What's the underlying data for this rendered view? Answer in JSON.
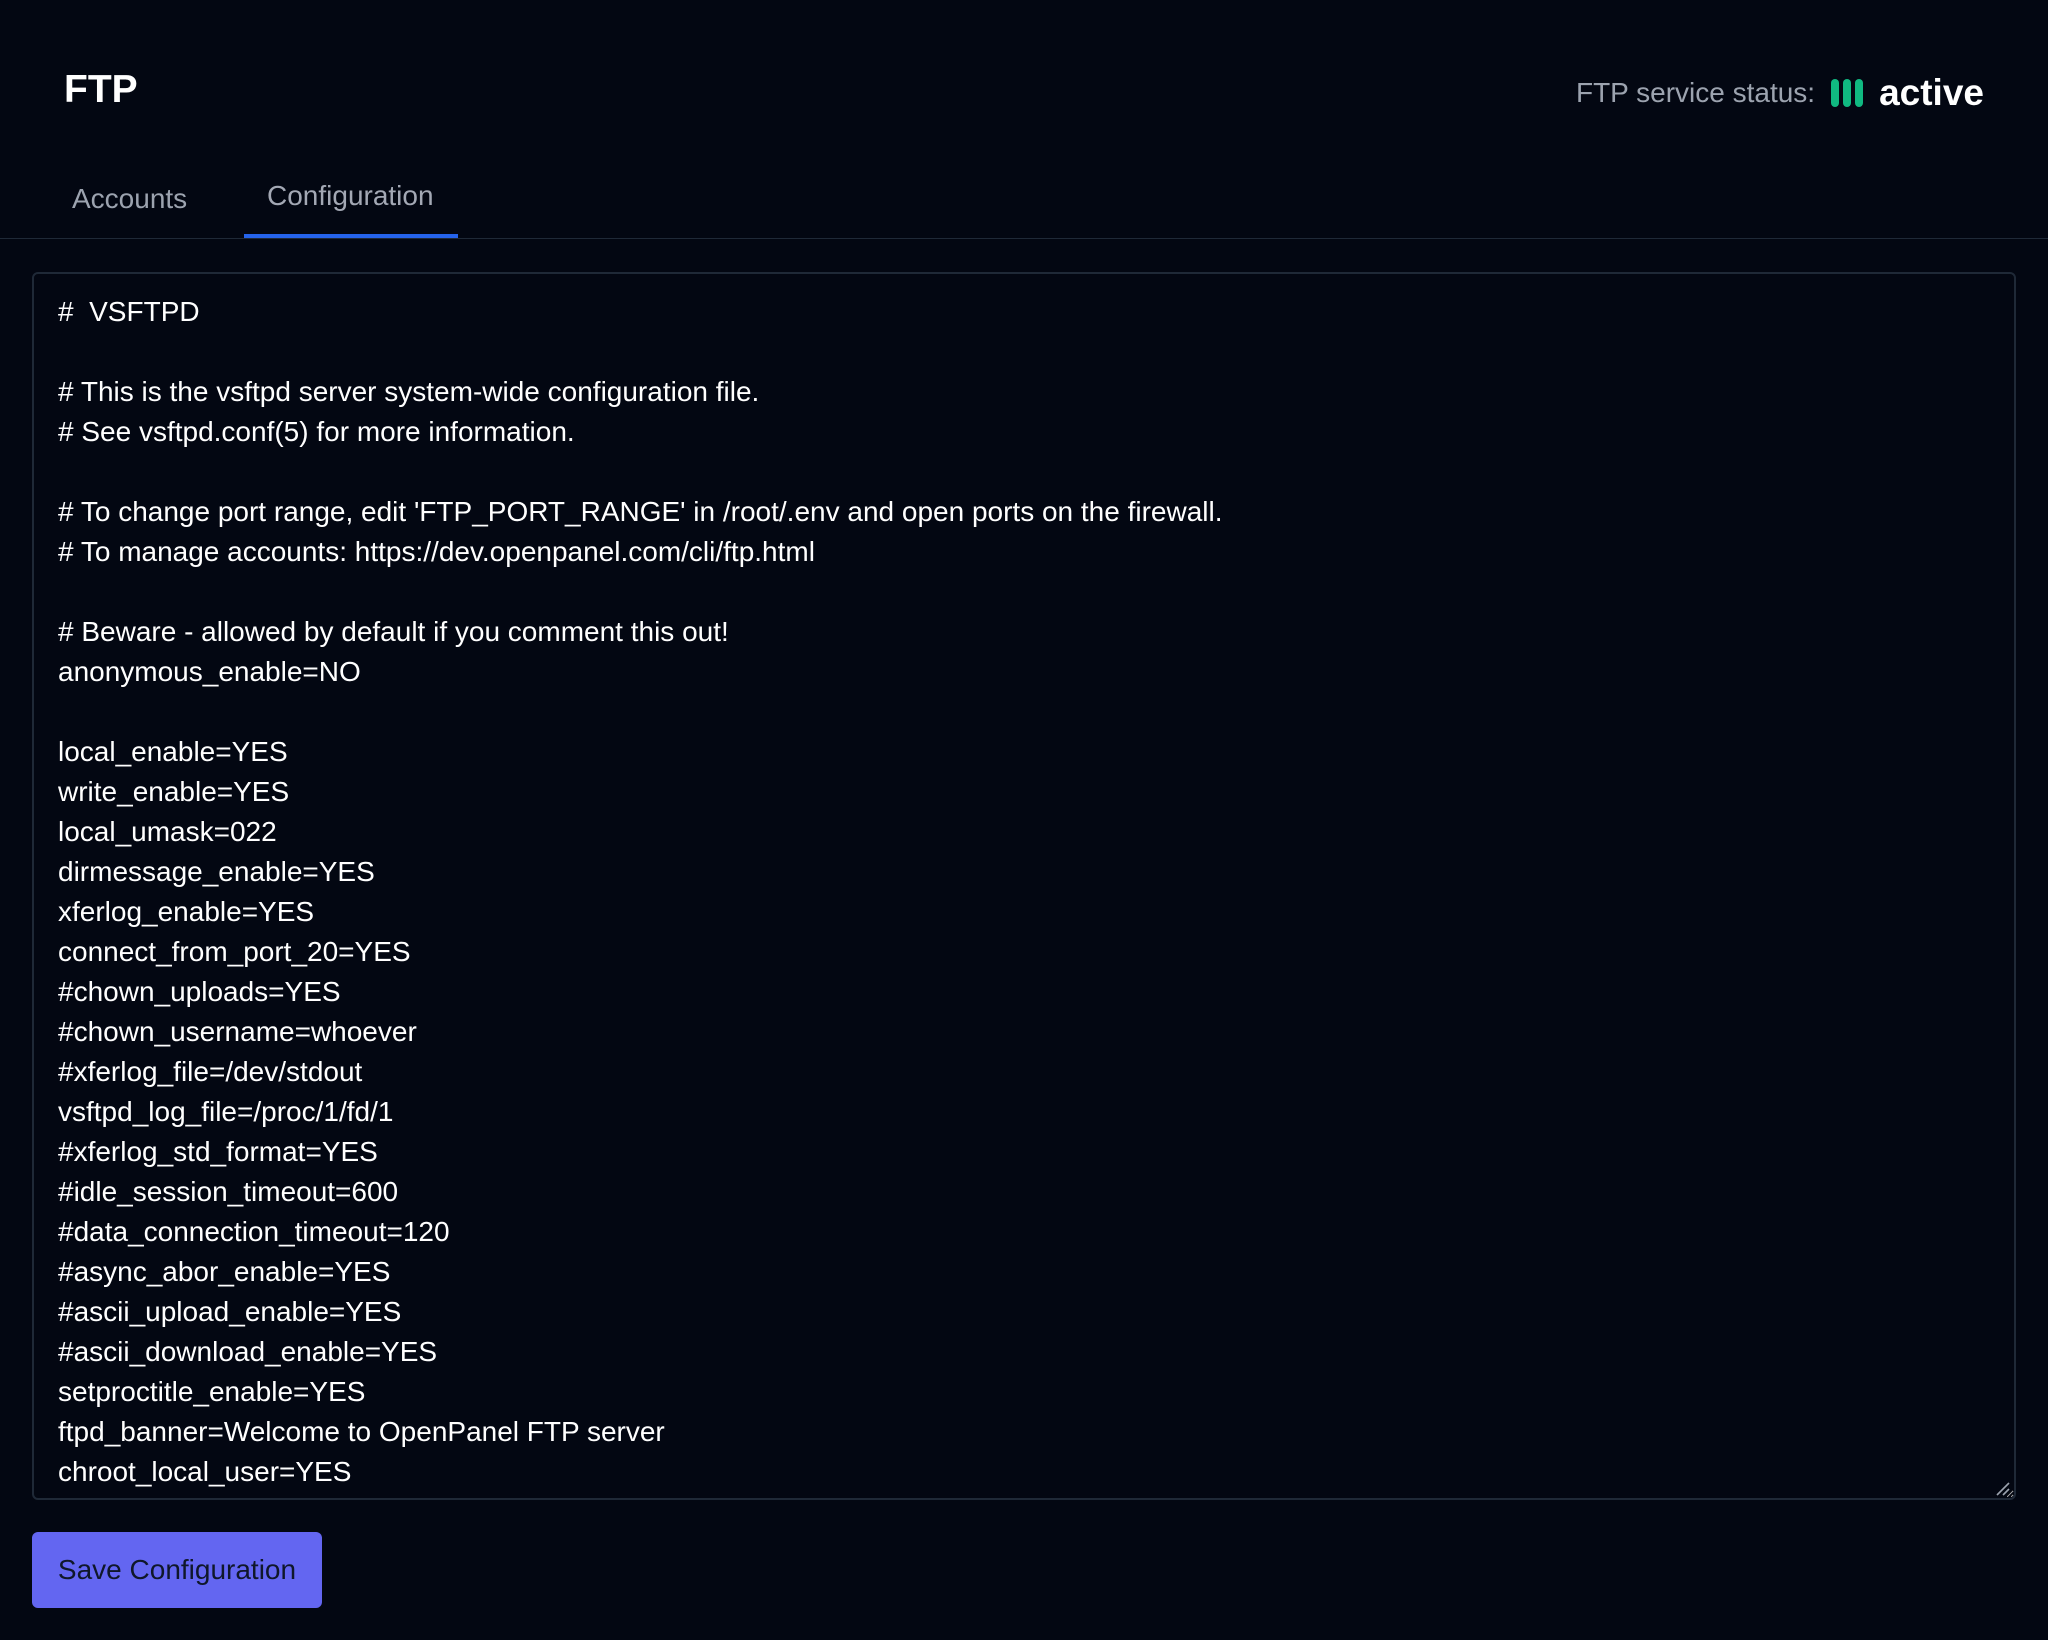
{
  "header": {
    "title": "FTP",
    "status_label": "FTP service status:",
    "status_value": "active",
    "status_icon": "running-bars-icon",
    "status_color": "#10b981"
  },
  "tabs": [
    {
      "label": "Accounts",
      "active": false
    },
    {
      "label": "Configuration",
      "active": true
    }
  ],
  "editor": {
    "content": "#  VSFTPD\n\n# This is the vsftpd server system-wide configuration file.\n# See vsftpd.conf(5) for more information.\n\n# To change port range, edit 'FTP_PORT_RANGE' in /root/.env and open ports on the firewall.\n# To manage accounts: https://dev.openpanel.com/cli/ftp.html\n\n# Beware - allowed by default if you comment this out!\nanonymous_enable=NO\n\nlocal_enable=YES\nwrite_enable=YES\nlocal_umask=022\ndirmessage_enable=YES\nxferlog_enable=YES\nconnect_from_port_20=YES\n#chown_uploads=YES\n#chown_username=whoever\n#xferlog_file=/dev/stdout\nvsftpd_log_file=/proc/1/fd/1\n#xferlog_std_format=YES\n#idle_session_timeout=600\n#data_connection_timeout=120\n#async_abor_enable=YES\n#ascii_upload_enable=YES\n#ascii_download_enable=YES\nsetproctitle_enable=YES\nftpd_banner=Welcome to OpenPanel FTP server\nchroot_local_user=YES"
  },
  "actions": {
    "save_label": "Save Configuration",
    "accent_color": "#6366f1"
  }
}
